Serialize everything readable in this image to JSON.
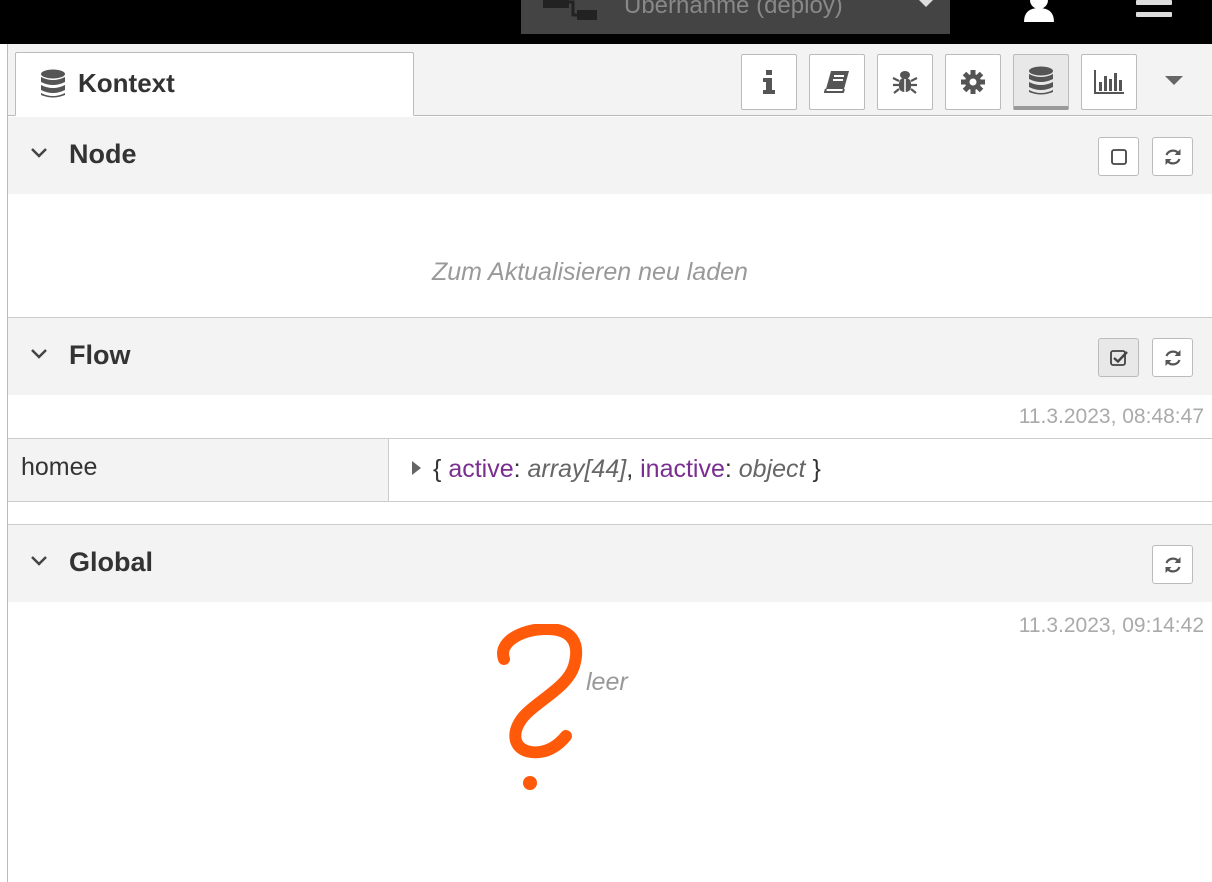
{
  "header": {
    "deploy_label": "Übernahme (deploy)",
    "icons": [
      "deploy-icon",
      "user-icon",
      "menu-icon"
    ]
  },
  "sidebar": {
    "tab": {
      "label": "Kontext",
      "icon": "database-icon"
    },
    "toolbar": [
      {
        "name": "info",
        "icon": "info-icon"
      },
      {
        "name": "help",
        "icon": "book-icon"
      },
      {
        "name": "debug",
        "icon": "bug-icon"
      },
      {
        "name": "config",
        "icon": "gear-icon"
      },
      {
        "name": "context",
        "icon": "database-icon",
        "active": true
      },
      {
        "name": "dashboard",
        "icon": "bar-chart-icon"
      }
    ]
  },
  "sections": {
    "node": {
      "title": "Node",
      "placeholder": "Zum Aktualisieren neu laden",
      "auto_refresh_checked": false
    },
    "flow": {
      "title": "Flow",
      "timestamp": "11.3.2023, 08:48:47",
      "auto_refresh_checked": true,
      "entries": [
        {
          "key": "homee",
          "open": "{",
          "prop1": "active",
          "type1": "array[44]",
          "prop2": "inactive",
          "type2": "object",
          "close": "}"
        }
      ]
    },
    "global": {
      "title": "Global",
      "timestamp": "11.3.2023, 09:14:42",
      "empty_text": "leer"
    }
  },
  "annotation": {
    "color": "#ff5a0a",
    "shape": "question-mark"
  }
}
